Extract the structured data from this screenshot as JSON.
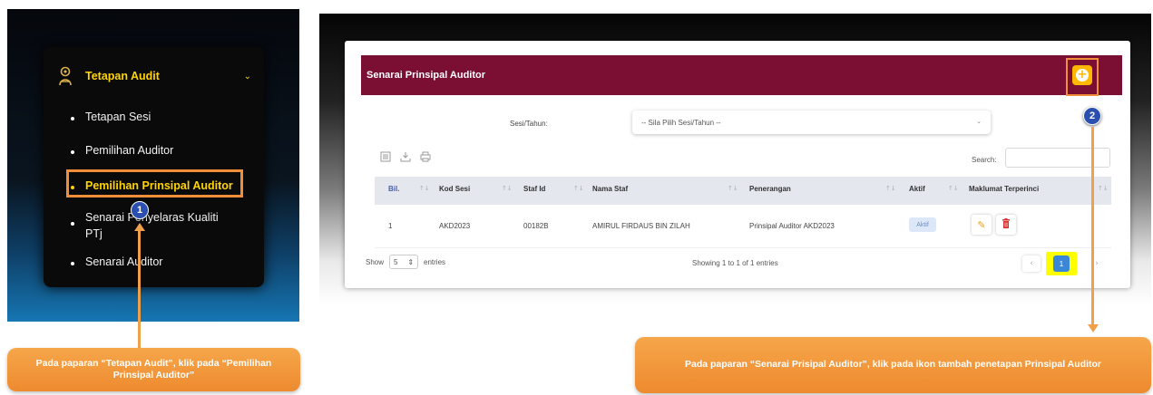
{
  "left_menu": {
    "header": "Tetapan Audit",
    "items": [
      {
        "label": "Tetapan Sesi"
      },
      {
        "label": "Pemilihan Auditor"
      },
      {
        "label": "Pemilihan Prinsipal Auditor"
      },
      {
        "label_line1": "Senarai Penyelaras Kualiti",
        "label_line2": "PTj"
      },
      {
        "label": "Senarai Auditor"
      }
    ]
  },
  "badges": {
    "step1": "1",
    "step2": "2"
  },
  "callouts": {
    "left": "Pada paparan “Tetapan Audit”,  klik pada “Pemilihan Prinsipal Auditor”",
    "right": "Pada paparan “Senarai Prisipal Auditor”, klik pada ikon tambah penetapan Prinsipal Auditor"
  },
  "panel": {
    "title": "Senarai Prinsipal Auditor",
    "filter_label": "Sesi/Tahun:",
    "filter_placeholder": "-- Sila Pilih Sesi/Tahun --",
    "search_label": "Search:",
    "columns": [
      "Bil.",
      "Kod Sesi",
      "Staf Id",
      "Nama Staf",
      "Penerangan",
      "Aktif",
      "Maklumat Terperinci"
    ],
    "rows": [
      {
        "bil": "1",
        "kod_sesi": "AKD2023",
        "staf_id": "00182B",
        "nama_staf": "AMIRUL FIRDAUS BIN ZILAH",
        "penerangan": "Prinsipal Auditor AKD2023",
        "aktif": "Aktif"
      }
    ],
    "show_label": "Show",
    "page_length": "5",
    "entries_label": "entries",
    "info": "Showing 1 to 1 of 1 entries",
    "current_page": "1"
  },
  "icons": {
    "menu_header": "audit-gear-icon",
    "add": "plus-circle-icon",
    "edit": "pencil-icon",
    "delete": "trash-icon"
  },
  "colors": {
    "panel_header": "#7a0f33",
    "menu_active": "#ffd400",
    "highlight": "#f08f3a",
    "callout": "#ee8a2f",
    "add_button": "#ffb700",
    "badge": "#2a4fb0"
  }
}
